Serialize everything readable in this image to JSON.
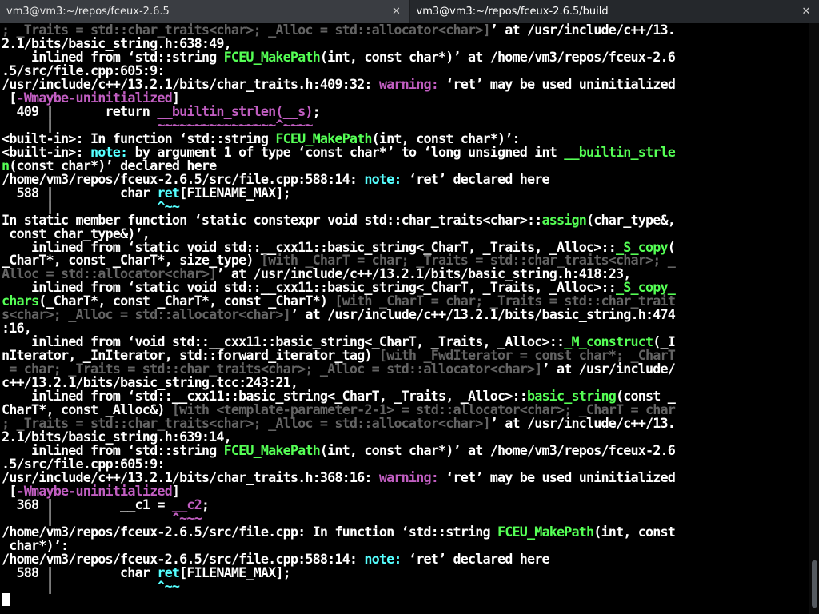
{
  "tabs": [
    {
      "title": "vm3@vm3:~/repos/fceux-2.6.5",
      "close_glyph": "✕",
      "active": false
    },
    {
      "title": "vm3@vm3:~/repos/fceux-2.6.5/build",
      "close_glyph": "✕",
      "active": true
    }
  ],
  "scroll": {
    "thumb_fraction_top": 0.91,
    "thumb_fraction_size": 0.08
  },
  "colors": {
    "background": "#000000",
    "text": "#ffffff",
    "function_highlight": "#55ff55",
    "warning": "#c15ec1",
    "note": "#55ffff",
    "template_args": "#646464"
  },
  "lines": [
    [
      {
        "t": "; _Traits = std::char_traits<char>; _Alloc = std::allocator<char>]",
        "c": "d"
      },
      {
        "t": "’ at /usr/include/c++/13.",
        "c": "w"
      }
    ],
    [
      {
        "t": "2.1/bits/basic_string.h:638:49,",
        "c": "w"
      }
    ],
    [
      {
        "t": "    inlined from ‘std::string ",
        "c": "w"
      },
      {
        "t": "FCEU_MakePath",
        "c": "g"
      },
      {
        "t": "(int, const char*)’ at /home/vm3/repos/fceux-2.6",
        "c": "w"
      }
    ],
    [
      {
        "t": ".5/src/file.cpp:605:9:",
        "c": "w"
      }
    ],
    [
      {
        "t": "/usr/include/c++/13.2.1/bits/char_traits.h:409:32: ",
        "c": "w"
      },
      {
        "t": "warning:",
        "c": "m"
      },
      {
        "t": " ‘ret’ may be used uninitialized",
        "c": "w"
      }
    ],
    [
      {
        "t": " [",
        "c": "w"
      },
      {
        "t": "-Wmaybe-uninitialized",
        "c": "m"
      },
      {
        "t": "]",
        "c": "w"
      }
    ],
    [
      {
        "t": "  409 |       return ",
        "c": "w"
      },
      {
        "t": "__builtin_strlen(__s)",
        "c": "m"
      },
      {
        "t": ";",
        "c": "w"
      }
    ],
    [
      {
        "t": "      |              ",
        "c": "w"
      },
      {
        "t": "~~~~~~~~~~~~~~~~^~~~~",
        "c": "m"
      }
    ],
    [
      {
        "t": "<built-in>: In function ‘std::string ",
        "c": "w"
      },
      {
        "t": "FCEU_MakePath",
        "c": "g"
      },
      {
        "t": "(int, const char*)’:",
        "c": "w"
      }
    ],
    [
      {
        "t": "<built-in>: ",
        "c": "w"
      },
      {
        "t": "note:",
        "c": "c"
      },
      {
        "t": " by argument 1 of type ‘const char*’ to ‘long unsigned int ",
        "c": "w"
      },
      {
        "t": "__builtin_strle",
        "c": "g"
      }
    ],
    [
      {
        "t": "n",
        "c": "g"
      },
      {
        "t": "(const char*)’ declared here",
        "c": "w"
      }
    ],
    [
      {
        "t": "/home/vm3/repos/fceux-2.6.5/src/file.cpp:588:14: ",
        "c": "w"
      },
      {
        "t": "note:",
        "c": "c"
      },
      {
        "t": " ‘ret’ declared here",
        "c": "w"
      }
    ],
    [
      {
        "t": "  588 |         char ",
        "c": "w"
      },
      {
        "t": "ret",
        "c": "c"
      },
      {
        "t": "[FILENAME_MAX];",
        "c": "w"
      }
    ],
    [
      {
        "t": "      |              ",
        "c": "w"
      },
      {
        "t": "^~~",
        "c": "c"
      }
    ],
    [
      {
        "t": "In static member function ‘static constexpr void std::char_traits<char>::",
        "c": "w"
      },
      {
        "t": "assign",
        "c": "g"
      },
      {
        "t": "(char_type&,",
        "c": "w"
      }
    ],
    [
      {
        "t": " const char_type&)’,",
        "c": "w"
      }
    ],
    [
      {
        "t": "    inlined from ‘static void std::__cxx11::basic_string<_CharT, _Traits, _Alloc>::",
        "c": "w"
      },
      {
        "t": "_S_copy",
        "c": "g"
      },
      {
        "t": "(",
        "c": "w"
      }
    ],
    [
      {
        "t": "_CharT*, const _CharT*, size_type) ",
        "c": "w"
      },
      {
        "t": "[with _CharT = char; _Traits = std::char_traits<char>; _",
        "c": "d"
      }
    ],
    [
      {
        "t": "Alloc = std::allocator<char>]",
        "c": "d"
      },
      {
        "t": "’ at /usr/include/c++/13.2.1/bits/basic_string.h:418:23,",
        "c": "w"
      }
    ],
    [
      {
        "t": "    inlined from ‘static void std::__cxx11::basic_string<_CharT, _Traits, _Alloc>::",
        "c": "w"
      },
      {
        "t": "_S_copy_",
        "c": "g"
      }
    ],
    [
      {
        "t": "chars",
        "c": "g"
      },
      {
        "t": "(_CharT*, const _CharT*, const _CharT*) ",
        "c": "w"
      },
      {
        "t": "[with _CharT = char; _Traits = std::char_trait",
        "c": "d"
      }
    ],
    [
      {
        "t": "s<char>; _Alloc = std::allocator<char>]",
        "c": "d"
      },
      {
        "t": "’ at /usr/include/c++/13.2.1/bits/basic_string.h:474",
        "c": "w"
      }
    ],
    [
      {
        "t": ":16,",
        "c": "w"
      }
    ],
    [
      {
        "t": "    inlined from ‘void std::__cxx11::basic_string<_CharT, _Traits, _Alloc>::",
        "c": "w"
      },
      {
        "t": "_M_construct",
        "c": "g"
      },
      {
        "t": "(_I",
        "c": "w"
      }
    ],
    [
      {
        "t": "nIterator, _InIterator, std::forward_iterator_tag) ",
        "c": "w"
      },
      {
        "t": "[with _FwdIterator = const char*; _CharT",
        "c": "d"
      }
    ],
    [
      {
        "t": " = char; _Traits = std::char_traits<char>; _Alloc = std::allocator<char>]",
        "c": "d"
      },
      {
        "t": "’ at /usr/include/",
        "c": "w"
      }
    ],
    [
      {
        "t": "c++/13.2.1/bits/basic_string.tcc:243:21,",
        "c": "w"
      }
    ],
    [
      {
        "t": "    inlined from ‘std::__cxx11::basic_string<_CharT, _Traits, _Alloc>::",
        "c": "w"
      },
      {
        "t": "basic_string",
        "c": "g"
      },
      {
        "t": "(const _",
        "c": "w"
      }
    ],
    [
      {
        "t": "CharT*, const _Alloc&) ",
        "c": "w"
      },
      {
        "t": "[with <template-parameter-2-1> = std::allocator<char>; _CharT = char",
        "c": "d"
      }
    ],
    [
      {
        "t": "; _Traits = std::char_traits<char>; _Alloc = std::allocator<char>]",
        "c": "d"
      },
      {
        "t": "’ at /usr/include/c++/13.",
        "c": "w"
      }
    ],
    [
      {
        "t": "2.1/bits/basic_string.h:639:14,",
        "c": "w"
      }
    ],
    [
      {
        "t": "    inlined from ‘std::string ",
        "c": "w"
      },
      {
        "t": "FCEU_MakePath",
        "c": "g"
      },
      {
        "t": "(int, const char*)’ at /home/vm3/repos/fceux-2.6",
        "c": "w"
      }
    ],
    [
      {
        "t": ".5/src/file.cpp:605:9:",
        "c": "w"
      }
    ],
    [
      {
        "t": "/usr/include/c++/13.2.1/bits/char_traits.h:368:16: ",
        "c": "w"
      },
      {
        "t": "warning:",
        "c": "m"
      },
      {
        "t": " ‘ret’ may be used uninitialized",
        "c": "w"
      }
    ],
    [
      {
        "t": " [",
        "c": "w"
      },
      {
        "t": "-Wmaybe-uninitialized",
        "c": "m"
      },
      {
        "t": "]",
        "c": "w"
      }
    ],
    [
      {
        "t": "  368 |         __c1 = ",
        "c": "w"
      },
      {
        "t": "__c2",
        "c": "m"
      },
      {
        "t": ";",
        "c": "w"
      }
    ],
    [
      {
        "t": "      |                ",
        "c": "w"
      },
      {
        "t": "^~~~",
        "c": "m"
      }
    ],
    [
      {
        "t": "/home/vm3/repos/fceux-2.6.5/src/file.cpp: In function ‘std::string ",
        "c": "w"
      },
      {
        "t": "FCEU_MakePath",
        "c": "g"
      },
      {
        "t": "(int, const",
        "c": "w"
      }
    ],
    [
      {
        "t": " char*)’:",
        "c": "w"
      }
    ],
    [
      {
        "t": "/home/vm3/repos/fceux-2.6.5/src/file.cpp:588:14: ",
        "c": "w"
      },
      {
        "t": "note:",
        "c": "c"
      },
      {
        "t": " ‘ret’ declared here",
        "c": "w"
      }
    ],
    [
      {
        "t": "  588 |         char ",
        "c": "w"
      },
      {
        "t": "ret",
        "c": "c"
      },
      {
        "t": "[FILENAME_MAX];",
        "c": "w"
      }
    ],
    [
      {
        "t": "      |              ",
        "c": "w"
      },
      {
        "t": "^~~",
        "c": "c"
      }
    ],
    []
  ]
}
